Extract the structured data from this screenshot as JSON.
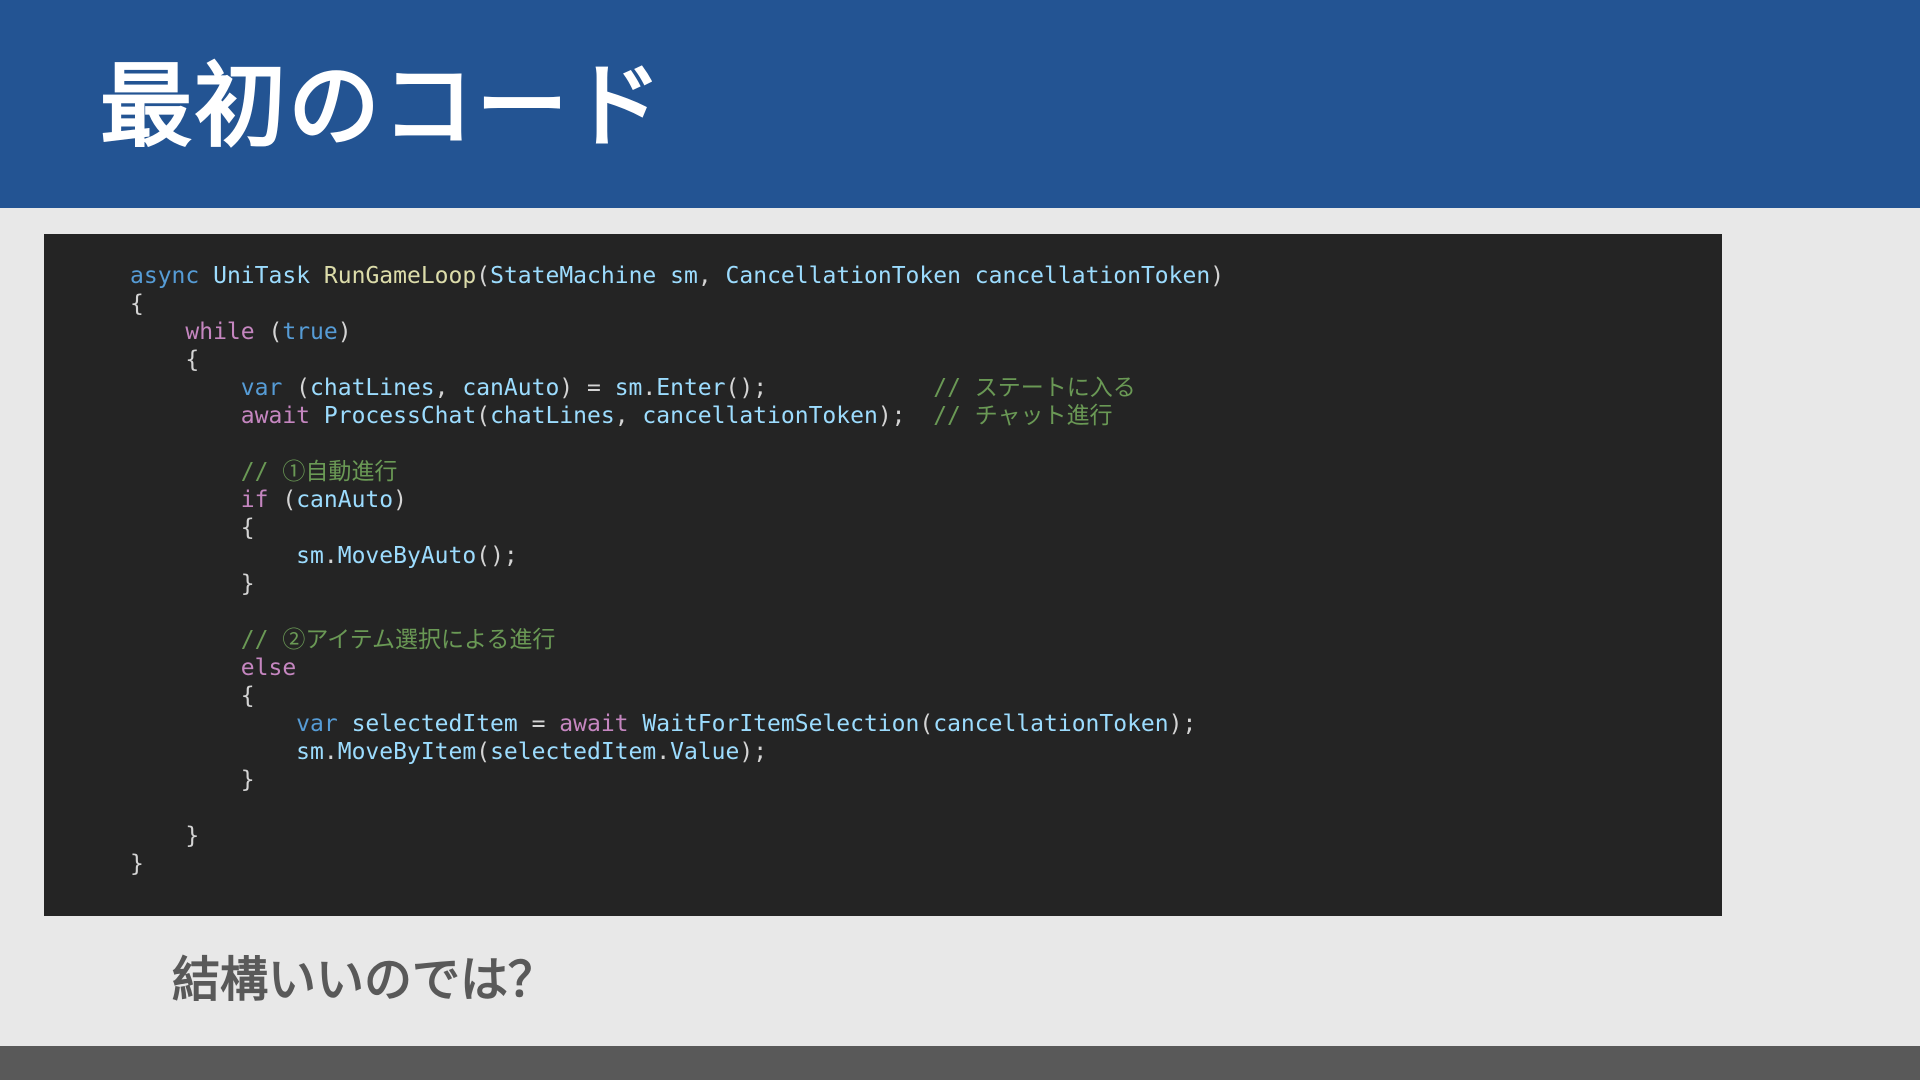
{
  "slide": {
    "title": "最初のコード",
    "caption": "結構いいのでは？"
  },
  "code": {
    "language": "csharp",
    "lines": [
      [
        [
          "kw",
          "async"
        ],
        [
          "p",
          " "
        ],
        [
          "typ",
          "UniTask"
        ],
        [
          "p",
          " "
        ],
        [
          "fn",
          "RunGameLoop"
        ],
        [
          "p",
          "("
        ],
        [
          "typ",
          "StateMachine"
        ],
        [
          "p",
          " "
        ],
        [
          "var",
          "sm"
        ],
        [
          "p",
          ", "
        ],
        [
          "typ",
          "CancellationToken"
        ],
        [
          "p",
          " "
        ],
        [
          "var",
          "cancellationToken"
        ],
        [
          "p",
          ")"
        ]
      ],
      [
        [
          "p",
          "{"
        ]
      ],
      [
        [
          "p",
          "    "
        ],
        [
          "ctl",
          "while"
        ],
        [
          "p",
          " ("
        ],
        [
          "kw",
          "true"
        ],
        [
          "p",
          ")"
        ]
      ],
      [
        [
          "p",
          "    {"
        ]
      ],
      [
        [
          "p",
          "        "
        ],
        [
          "kw",
          "var"
        ],
        [
          "p",
          " ("
        ],
        [
          "var",
          "chatLines"
        ],
        [
          "p",
          ", "
        ],
        [
          "var",
          "canAuto"
        ],
        [
          "p",
          ") = "
        ],
        [
          "var",
          "sm"
        ],
        [
          "p",
          "."
        ],
        [
          "var",
          "Enter"
        ],
        [
          "p",
          "();            "
        ],
        [
          "cmt",
          "// ステートに入る"
        ]
      ],
      [
        [
          "p",
          "        "
        ],
        [
          "ctl",
          "await"
        ],
        [
          "p",
          " "
        ],
        [
          "var",
          "ProcessChat"
        ],
        [
          "p",
          "("
        ],
        [
          "var",
          "chatLines"
        ],
        [
          "p",
          ", "
        ],
        [
          "var",
          "cancellationToken"
        ],
        [
          "p",
          ");  "
        ],
        [
          "cmt",
          "// チャット進行"
        ]
      ],
      [
        [
          "p",
          ""
        ]
      ],
      [
        [
          "p",
          "        "
        ],
        [
          "cmt",
          "// ①自動進行"
        ]
      ],
      [
        [
          "p",
          "        "
        ],
        [
          "ctl",
          "if"
        ],
        [
          "p",
          " ("
        ],
        [
          "var",
          "canAuto"
        ],
        [
          "p",
          ")"
        ]
      ],
      [
        [
          "p",
          "        {"
        ]
      ],
      [
        [
          "p",
          "            "
        ],
        [
          "var",
          "sm"
        ],
        [
          "p",
          "."
        ],
        [
          "var",
          "MoveByAuto"
        ],
        [
          "p",
          "();"
        ]
      ],
      [
        [
          "p",
          "        }"
        ]
      ],
      [
        [
          "p",
          ""
        ]
      ],
      [
        [
          "p",
          "        "
        ],
        [
          "cmt",
          "// ②アイテム選択による進行"
        ]
      ],
      [
        [
          "p",
          "        "
        ],
        [
          "ctl",
          "else"
        ]
      ],
      [
        [
          "p",
          "        {"
        ]
      ],
      [
        [
          "p",
          "            "
        ],
        [
          "kw",
          "var"
        ],
        [
          "p",
          " "
        ],
        [
          "var",
          "selectedItem"
        ],
        [
          "p",
          " = "
        ],
        [
          "ctl",
          "await"
        ],
        [
          "p",
          " "
        ],
        [
          "var",
          "WaitForItemSelection"
        ],
        [
          "p",
          "("
        ],
        [
          "var",
          "cancellationToken"
        ],
        [
          "p",
          ");"
        ]
      ],
      [
        [
          "p",
          "            "
        ],
        [
          "var",
          "sm"
        ],
        [
          "p",
          "."
        ],
        [
          "var",
          "MoveByItem"
        ],
        [
          "p",
          "("
        ],
        [
          "var",
          "selectedItem"
        ],
        [
          "p",
          "."
        ],
        [
          "var",
          "Value"
        ],
        [
          "p",
          ");"
        ]
      ],
      [
        [
          "p",
          "        }"
        ]
      ],
      [
        [
          "p",
          ""
        ]
      ],
      [
        [
          "p",
          "    }"
        ]
      ],
      [
        [
          "p",
          "}"
        ]
      ]
    ]
  },
  "colors": {
    "header_bg": "#235493",
    "slide_bg": "#e8e8e8",
    "code_bg": "#242424",
    "footer_bg": "#595959",
    "caption_text": "#595959"
  }
}
